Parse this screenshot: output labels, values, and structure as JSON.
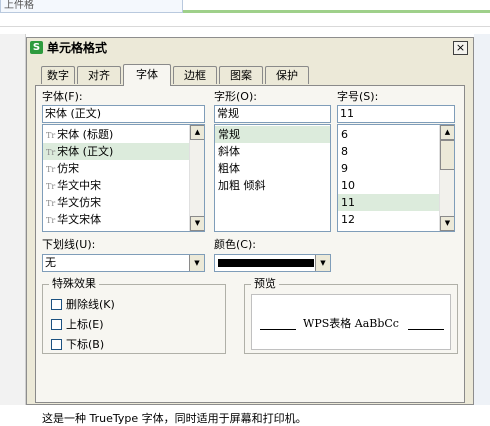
{
  "background": {
    "name_box": "上件格"
  },
  "dialog": {
    "icon_glyph": "S",
    "title": "单元格格式",
    "close_glyph": "×",
    "tabs": [
      {
        "label": "数字"
      },
      {
        "label": "对齐"
      },
      {
        "label": "字体",
        "active": true
      },
      {
        "label": "边框"
      },
      {
        "label": "图案"
      },
      {
        "label": "保护"
      }
    ],
    "font": {
      "label": "字体(F):",
      "value": "宋体 (正文)",
      "items": [
        "宋体 (标题)",
        "宋体 (正文)",
        "仿宋",
        "华文中宋",
        "华文仿宋",
        "华文宋体"
      ],
      "selected_index": 1,
      "truetype_glyph": "Tr"
    },
    "style": {
      "label": "字形(O):",
      "value": "常规",
      "items": [
        "常规",
        "斜体",
        "粗体",
        "加粗 倾斜"
      ],
      "selected_index": 0
    },
    "size": {
      "label": "字号(S):",
      "value": "11",
      "items": [
        "6",
        "8",
        "9",
        "10",
        "11",
        "12"
      ],
      "selected_index": 4
    },
    "underline": {
      "label": "下划线(U):",
      "value": "无"
    },
    "color": {
      "label": "颜色(C):",
      "value": "#000000"
    },
    "effects": {
      "legend": "特殊效果",
      "strikethrough": "删除线(K)",
      "superscript": "上标(E)",
      "subscript": "下标(B)"
    },
    "preview": {
      "legend": "预览",
      "text": "WPS表格  AaBbCc"
    },
    "hint": "这是一种 TrueType 字体，同时适用于屏幕和打印机。",
    "scroll_up_glyph": "▲",
    "scroll_down_glyph": "▼"
  }
}
